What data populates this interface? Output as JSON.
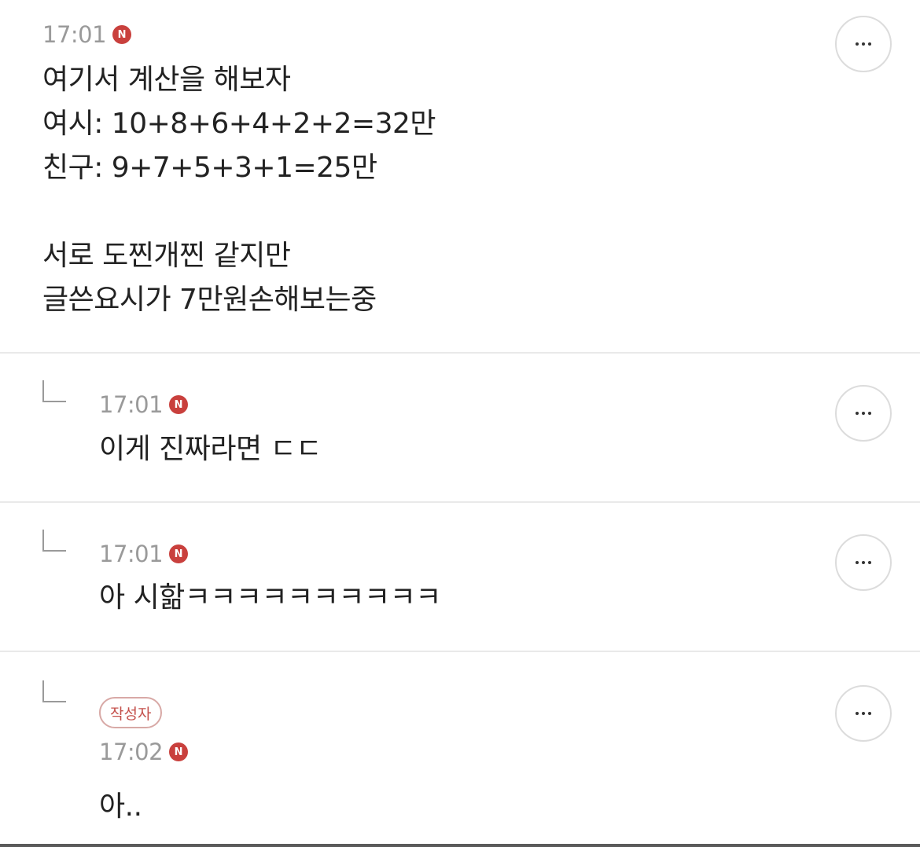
{
  "comments": [
    {
      "time": "17:01",
      "badge": "N",
      "text": "여기서 계산을 해보자\n여시: 10+8+6+4+2+2=32만\n친구: 9+7+5+3+1=25만\n\n서로 도찐개찐 같지만\n글쓴요시가 7만원손해보는중"
    },
    {
      "time": "17:01",
      "badge": "N",
      "text": "이게 진짜라면 ㄷㄷ"
    },
    {
      "time": "17:01",
      "badge": "N",
      "text": "아 시핢ㅋㅋㅋㅋㅋㅋㅋㅋㅋㅋ"
    },
    {
      "author_label": "작성자",
      "time": "17:02",
      "badge": "N",
      "text": "아.."
    }
  ],
  "colors": {
    "badge": "#c9403d",
    "time": "#9a9a9a",
    "text": "#222222",
    "author_badge": "#c4504b",
    "divider": "#e9e9e9"
  },
  "icons": {
    "more": "more-horizontal-icon",
    "reply": "reply-corner-icon",
    "new": "new-badge-icon"
  }
}
